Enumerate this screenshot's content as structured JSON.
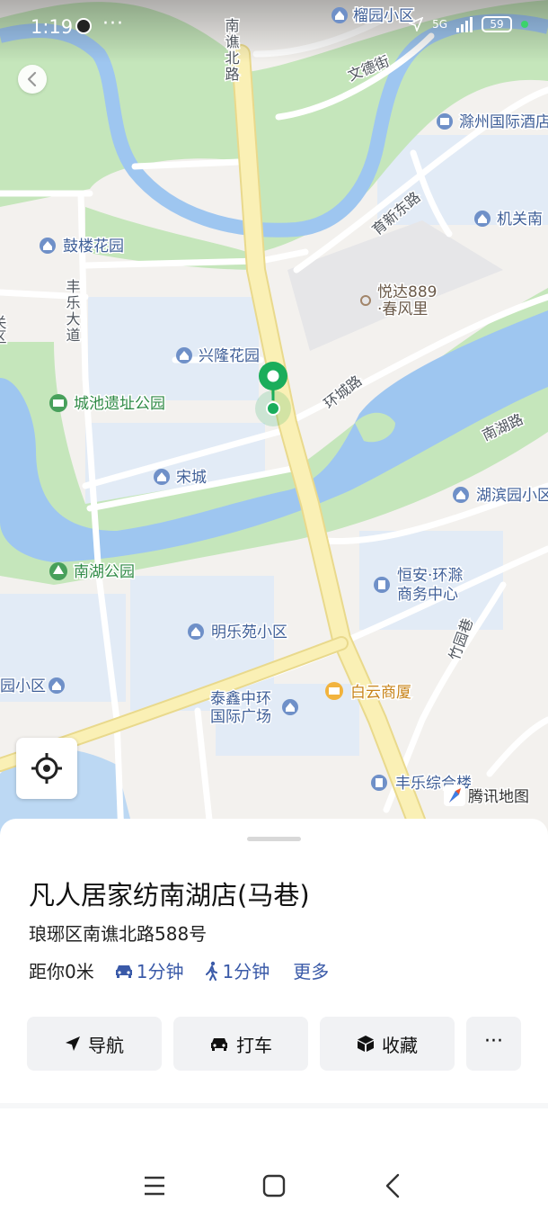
{
  "status_bar": {
    "time": "1:19",
    "dots": "···",
    "network": "5G",
    "battery": "59"
  },
  "map": {
    "roads": {
      "nanqiao_north": "南谯北路",
      "wende": "文德街",
      "yuxin_east": "育新东路",
      "fengle": "丰乐大道",
      "huancheng": "环城路",
      "nanhu": "南湖路",
      "zhuyuan": "竹园巷"
    },
    "pois": {
      "liuyuan": "榴园小区",
      "chuzhou_hotel": "滁州国际酒店",
      "jiguan": "机关南",
      "gulou": "鼓楼花园",
      "yueda_1": "悦达889",
      "yueda_2": "·春风里",
      "xinglong": "兴隆花园",
      "chengchi": "城池遗址公园",
      "songcheng": "宋城",
      "hubin": "湖滨园小区",
      "nanhu_park": "南湖公园",
      "hengan_1": "恒安·环滁",
      "hengan_2": "商务中心",
      "minglecyuan": "明乐苑小区",
      "left_community": "园小区",
      "taixin_1": "泰鑫中环",
      "taixin_2": "国际广场",
      "baiyun": "白云商厦",
      "fengle_building": "丰乐综合楼",
      "edge_left": "关区"
    },
    "brand": "腾讯地图",
    "colors": {
      "land": "#f3f1ee",
      "water": "#9ec6f0",
      "park": "#bfe5b6",
      "highway": "#f9eba3",
      "marker": "#1aad5b"
    }
  },
  "place": {
    "name": "凡人居家纺南湖店(马巷)",
    "address": "琅琊区南谯北路588号",
    "distance": "距你0米",
    "drive_time": "1分钟",
    "walk_time": "1分钟",
    "more": "更多"
  },
  "actions": {
    "navigate": "导航",
    "taxi": "打车",
    "favorite": "收藏",
    "more": "···"
  }
}
